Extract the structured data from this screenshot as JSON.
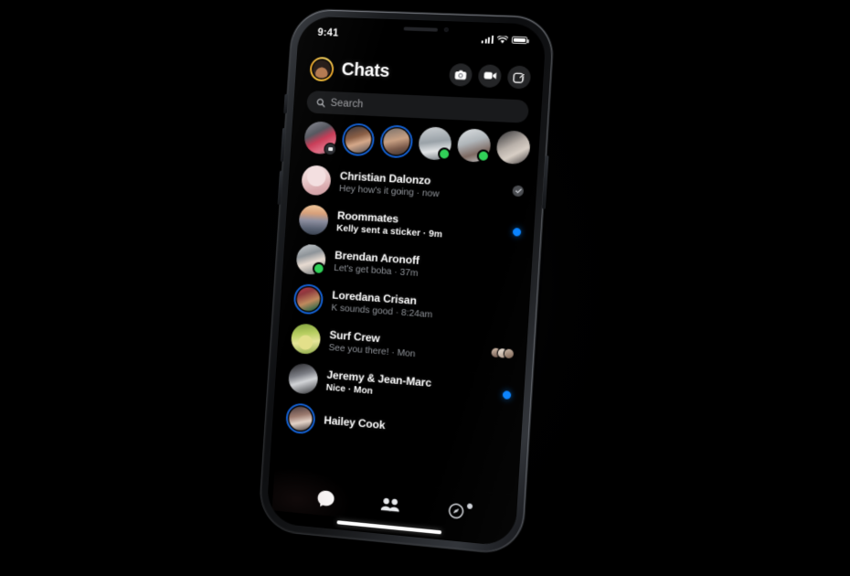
{
  "status_bar": {
    "time": "9:41",
    "cellular_icon": "signal-bars-icon",
    "wifi_icon": "wifi-icon",
    "battery_icon": "battery-icon"
  },
  "header": {
    "avatar_name": "profile-avatar",
    "title": "Chats",
    "actions": [
      {
        "name": "camera-button",
        "icon": "camera-icon"
      },
      {
        "name": "video-call-button",
        "icon": "video-camera-icon"
      },
      {
        "name": "new-message-button",
        "icon": "compose-icon"
      }
    ]
  },
  "search": {
    "placeholder": "Search",
    "icon": "search-icon"
  },
  "stories": [
    {
      "name": "your-story",
      "ring": "none",
      "badge": "camera",
      "bg": "linear-gradient(150deg,#8d8f98 0%,#54565e 35%,#c83b56 55%,#e06a82 75%,#6c6e77 100%)"
    },
    {
      "name": "story-2",
      "ring": "blue",
      "badge": "none",
      "bg": "linear-gradient(160deg,#2a2f3a 0%,#8a5f46 40%,#d6a98a 60%,#3b3f4a 100%)"
    },
    {
      "name": "story-3",
      "ring": "blue",
      "badge": "none",
      "bg": "linear-gradient(165deg,#6e6a68 0%,#c9a184 45%,#7a5a4a 70%,#2e2b2c 100%)"
    },
    {
      "name": "story-4",
      "ring": "none",
      "badge": "online",
      "bg": "linear-gradient(170deg,#cfd3d6 0%,#9aa2a8 45%,#e3e5e7 70%,#6e757b 100%)"
    },
    {
      "name": "story-5",
      "ring": "none",
      "badge": "online",
      "bg": "linear-gradient(160deg,#dfe2e4 0%,#b0b6ba 40%,#7d6a62 70%,#cfd4d7 100%)"
    },
    {
      "name": "story-6",
      "ring": "none",
      "badge": "none",
      "bg": "linear-gradient(150deg,#2b2b2e 0%,#b9b1aa 45%,#d8cfc6 65%,#3a3638 100%)"
    }
  ],
  "chats": [
    {
      "name": "Christian Dalonzo",
      "snippet": "Hey how's it going · now",
      "unread": false,
      "status": "seen-check",
      "avatar_ring": "none",
      "online": false,
      "avatar_bg": "radial-gradient(circle at 50% 38%, #f3dfe0 0 40%, rgba(243,223,224,0) 41%), linear-gradient(165deg,#f7e9ea 0%,#e8c9ca 45%,#d9a9ad 75%,#cfa0a6 100%)"
    },
    {
      "name": "Roommates",
      "snippet": "Kelly sent a sticker · 9m",
      "unread": true,
      "status": "unread-dot",
      "avatar_ring": "none",
      "online": false,
      "avatar_bg": "linear-gradient(180deg,#f0c79a 0%,#d9a07a 28%,#8e8fa0 52%,#5b6374 78%,#3c4452 100%)"
    },
    {
      "name": "Brendan Aronoff",
      "snippet": "Let's get boba · 37m",
      "unread": false,
      "status": "none",
      "avatar_ring": "none",
      "online": true,
      "avatar_bg": "linear-gradient(160deg,#c9cdd0 0%,#8e9499 35%,#e8dcd2 58%,#6d7479 100%)"
    },
    {
      "name": "Loredana Crisan",
      "snippet": "K sounds good · 8:24am",
      "unread": false,
      "status": "none",
      "avatar_ring": "blue",
      "online": false,
      "avatar_bg": "linear-gradient(155deg,#c0324a 0%,#8e3a3e 30%,#c08a5e 58%,#3e6b4a 82%,#22303a 100%)"
    },
    {
      "name": "Surf Crew",
      "snippet": "See you there! · Mon",
      "unread": false,
      "status": "seen-faces",
      "avatar_ring": "none",
      "online": false,
      "avatar_bg": "radial-gradient(circle at 50% 62%, #e3e08a 0 30%, rgba(227,224,138,0) 31%), linear-gradient(170deg,#7fa13c 0%,#b9cf62 35%,#e6e59a 60%,#8aa844 100%)"
    },
    {
      "name": "Jeremy & Jean-Marc",
      "snippet": "Nice · Mon",
      "unread": true,
      "status": "unread-dot",
      "avatar_ring": "none",
      "online": false,
      "avatar_bg": "linear-gradient(160deg,#1d1d20 0%,#7b7d84 38%,#d3d5d8 58%,#2a2b2f 100%)"
    },
    {
      "name": "Hailey Cook",
      "snippet": "",
      "unread": false,
      "status": "none",
      "avatar_ring": "blue",
      "online": false,
      "avatar_bg": "linear-gradient(165deg,#3a2f33 0%,#9b7a6e 40%,#e4d3c8 62%,#2b2426 100%)"
    }
  ],
  "tabs": [
    {
      "name": "tab-chats",
      "icon": "chat-bubble-icon",
      "active": true,
      "badge": false
    },
    {
      "name": "tab-people",
      "icon": "people-group-icon",
      "active": false,
      "badge": false
    },
    {
      "name": "tab-discover",
      "icon": "compass-icon",
      "active": false,
      "badge": true
    }
  ],
  "colors": {
    "accent_blue": "#0a84ff",
    "story_ring_blue": "#1463d8",
    "online_green": "#31d158",
    "screen_bg": "#000000",
    "chip_bg": "rgba(116,120,128,.22)"
  }
}
